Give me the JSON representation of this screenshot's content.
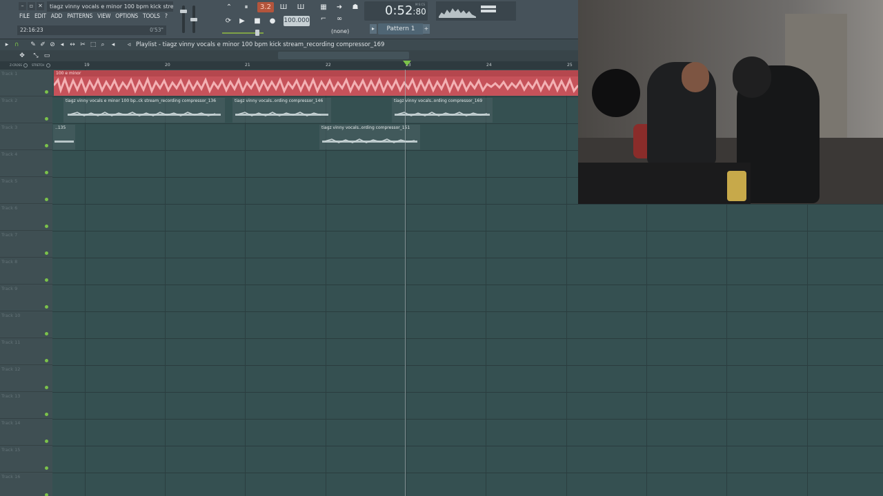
{
  "window": {
    "title": "tiagz vinny vocals e minor 100 bpm kick stream...",
    "time_display": "22:16:23",
    "time_secondary": "0'53\""
  },
  "menu": [
    "FILE",
    "EDIT",
    "ADD",
    "PATTERNS",
    "VIEW",
    "OPTIONS",
    "TOOLS",
    "?"
  ],
  "transport": {
    "step_mode": "3.2",
    "tempo": "100.000",
    "clock_main": "0:52",
    "clock_frac": "80",
    "clock_unit": "M:S:CS",
    "snap": "(none)",
    "pattern": "Pattern 1"
  },
  "playlist": {
    "title": "Playlist - tiagz vinny vocals e minor 100 bpm kick stream_recording compressor_169",
    "header_tags": [
      "Z-CROSS",
      "STRETCH"
    ],
    "ruler": [
      "19",
      "20",
      "21",
      "22",
      "23",
      "24",
      "25"
    ],
    "tracks": [
      "Track 1",
      "Track 2",
      "Track 3",
      "Track 4",
      "Track 5",
      "Track 6",
      "Track 7",
      "Track 8",
      "Track 9",
      "Track 10",
      "Track 11",
      "Track 12",
      "Track 13",
      "Track 14",
      "Track 15",
      "Track 16"
    ],
    "clips": {
      "c1": "100 e minor",
      "c2": "tiagz vinny vocals e minor 100 bp..ck stream_recording compressor_136",
      "c3": "tiagz vinny vocals..ording compressor_146",
      "c4": "tiagz vinny vocals..ording compressor_169",
      "c5": "..135",
      "c6": "tiagz vinny vocals..ording compressor_151"
    }
  },
  "colors": {
    "accent_red": "#c6525a",
    "grid_bg": "#355051",
    "mute_dot": "#7bc24a"
  },
  "icons": [
    "magnet-icon",
    "pencil-icon",
    "brush-icon",
    "delete-icon",
    "mute-icon",
    "slip-icon",
    "slice-icon",
    "select-icon",
    "zoom-icon",
    "playback-icon"
  ]
}
